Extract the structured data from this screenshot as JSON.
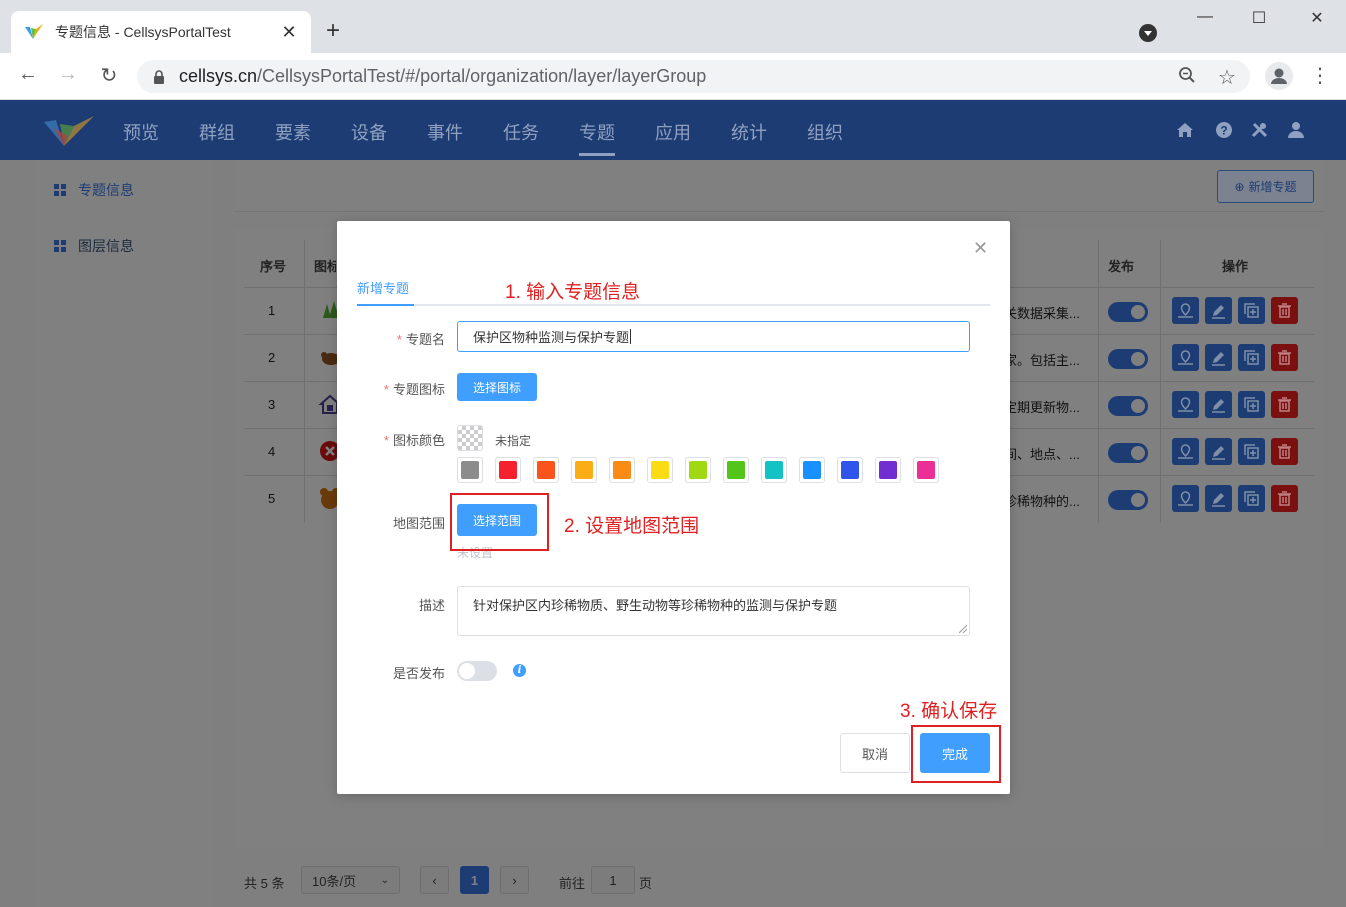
{
  "browser": {
    "tab_title": "专题信息 - CellsysPortalTest",
    "url_host": "cellsys.cn",
    "url_path": "/CellsysPortalTest/#/portal/organization/layer/layerGroup"
  },
  "nav": {
    "items": [
      "预览",
      "群组",
      "要素",
      "设备",
      "事件",
      "任务",
      "专题",
      "应用",
      "统计",
      "组织"
    ],
    "active": "专题"
  },
  "sidebar": {
    "items": [
      {
        "label": "专题信息",
        "active": true
      },
      {
        "label": "图层信息",
        "active": false
      }
    ]
  },
  "toolbar": {
    "add_topic_label": "新增专题"
  },
  "table": {
    "columns": {
      "index": "序号",
      "icon": "图标",
      "publish": "发布",
      "actions": "操作"
    },
    "rows": [
      {
        "index": "1",
        "desc": "关数据采集..."
      },
      {
        "index": "2",
        "desc": "家。包括主..."
      },
      {
        "index": "3",
        "desc": "定期更新物..."
      },
      {
        "index": "4",
        "desc": "间、地点、..."
      },
      {
        "index": "5",
        "desc": "珍稀物种的..."
      }
    ]
  },
  "pagination": {
    "total": "共 5 条",
    "page_size": "10条/页",
    "current_page": "1",
    "goto_prefix": "前往",
    "goto_value": "1",
    "goto_suffix": "页"
  },
  "modal": {
    "tab": "新增专题",
    "name_label": "专题名",
    "name_value": "保护区物种监测与保护专题",
    "icon_label": "专题图标",
    "icon_button": "选择图标",
    "color_label": "图标颜色",
    "color_unset": "未指定",
    "colors": [
      "#8c8c8c",
      "#f5222d",
      "#fa541c",
      "#faad14",
      "#fa8c16",
      "#fadb14",
      "#a0d911",
      "#52c41a",
      "#13c2c2",
      "#1890ff",
      "#2f54eb",
      "#722ed1",
      "#eb2f96"
    ],
    "range_label": "地图范围",
    "range_button": "选择范围",
    "range_status": "未设置",
    "desc_label": "描述",
    "desc_value": "针对保护区内珍稀物质、野生动物等珍稀物种的监测与保护专题",
    "publish_label": "是否发布",
    "cancel_button": "取消",
    "confirm_button": "完成"
  },
  "annotations": {
    "step1": "1. 输入专题信息",
    "step2": "2. 设置地图范围",
    "step3": "3. 确认保存"
  },
  "theme": {
    "primary": "#409eff",
    "nav_bg": "#1d3c73",
    "annotation": "#e02020"
  }
}
